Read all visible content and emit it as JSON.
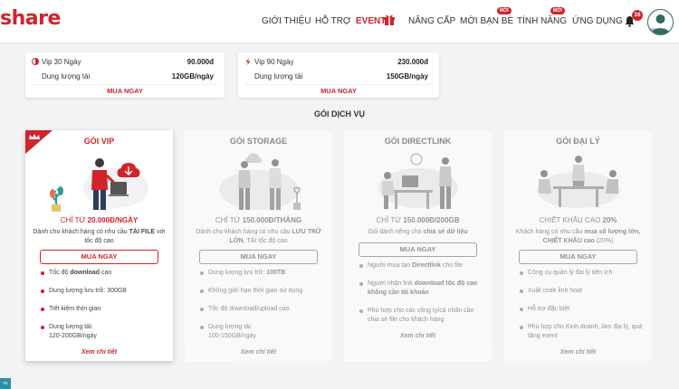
{
  "header": {
    "logo": "share",
    "nav": [
      "GIỚI THIỆU",
      "HỖ TRỢ",
      "EVENT",
      "NÂNG CẤP",
      "MỜI BẠN BÈ",
      "TÍNH NĂNG",
      "ỨNG DỤNG"
    ],
    "new_badge": "MỚI",
    "bell_count": "16",
    "avatar_label": "Member"
  },
  "price_boxes": [
    {
      "name": "Vip 30 Ngày",
      "price": "90.000đ",
      "quota_label": "Dung lượng tải",
      "quota": "120GB/ngày",
      "button": "MUA NGAY"
    },
    {
      "name": "Vip 90 Ngày",
      "price": "230.000đ",
      "quota_label": "Dung lượng tải",
      "quota": "150GB/ngày",
      "button": "MUA NGAY"
    }
  ],
  "section_title": "GÓI DỊCH VỤ",
  "cards": [
    {
      "title": "GÓI VIP",
      "price_prefix": "CHỈ TỪ ",
      "price_value": "20.000Đ/NGÀY",
      "desc_a": "Dành cho khách hàng có nhu cầu ",
      "desc_b": "TẢI FILE",
      "desc_c": " với tốc độ cao",
      "button": "MUA NGAY",
      "features": [
        {
          "a": "Tốc độ ",
          "b": "download",
          "c": " cao"
        },
        {
          "a": "Dung lượng lưu trữ: 300GB",
          "b": "",
          "c": ""
        },
        {
          "a": "Tiết kiệm thời gian",
          "b": "",
          "c": ""
        },
        {
          "a": "Dung lượng tải:",
          "b": "",
          "c": "120-200GB/ngày"
        }
      ],
      "more": "Xem chi tiết"
    },
    {
      "title": "GÓI STORAGE",
      "price_prefix": "CHỈ TỪ ",
      "price_value": "150.000Đ/THÁNG",
      "desc_a": "Dành cho khách hàng có nhu cầu ",
      "desc_b": "LƯU TRỮ LỚN",
      "desc_c": ", TẢI tốc độ cao",
      "button": "MUA NGAY",
      "features": [
        {
          "a": "Dung lượng lưu trữ: ",
          "b": "100TB",
          "c": ""
        },
        {
          "a": "Không giới hạn thời gian sử dụng",
          "b": "",
          "c": ""
        },
        {
          "a": "Tốc độ download/upload cao",
          "b": "",
          "c": ""
        },
        {
          "a": "Dung lượng tải:",
          "b": "",
          "c": "100-150GB/ngày"
        }
      ],
      "more": "Xem chi tiết"
    },
    {
      "title": "GÓI DIRECTLINK",
      "price_prefix": "CHỈ TỪ ",
      "price_value": "150.000Đ/200GB",
      "desc_a": "Gói dành riêng cho ",
      "desc_b": "chia sẻ dữ liệu",
      "desc_c": "",
      "button": "MUA NGAY",
      "features": [
        {
          "a": "Người mua tạo ",
          "b": "Directlink",
          "c": " cho file"
        },
        {
          "a": "Người nhận link ",
          "b": "download tốc độ cao không cần tài khoản",
          "c": ""
        },
        {
          "a": "Phù hợp cho các công ty/cá nhân cần chia sẻ file cho khách hàng",
          "b": "",
          "c": ""
        }
      ],
      "more": "Xem chi tiết"
    },
    {
      "title": "GÓI ĐẠI LÝ",
      "price_prefix": "CHIẾT KHẤU CAO ",
      "price_value": "20%",
      "desc_a": "Khách hàng có nhu cầu ",
      "desc_b": "mua số lượng lớn, CHIẾT KHẤU cao",
      "desc_c": " (20%)",
      "button": "MUA NGAY",
      "features": [
        {
          "a": "Công cụ quản lý đại lý tiện ích",
          "b": "",
          "c": ""
        },
        {
          "a": "Xuất code linh hoạt",
          "b": "",
          "c": ""
        },
        {
          "a": "Hỗ trợ đặc biệt",
          "b": "",
          "c": ""
        },
        {
          "a": "Phù hợp cho Kinh doanh, làm đại lý, quà tặng event",
          "b": "",
          "c": ""
        }
      ],
      "more": "Xem chi tiết"
    }
  ],
  "corner_tag": "vn",
  "colors": {
    "accent": "#d2232a",
    "background": "#f2f3f5"
  }
}
